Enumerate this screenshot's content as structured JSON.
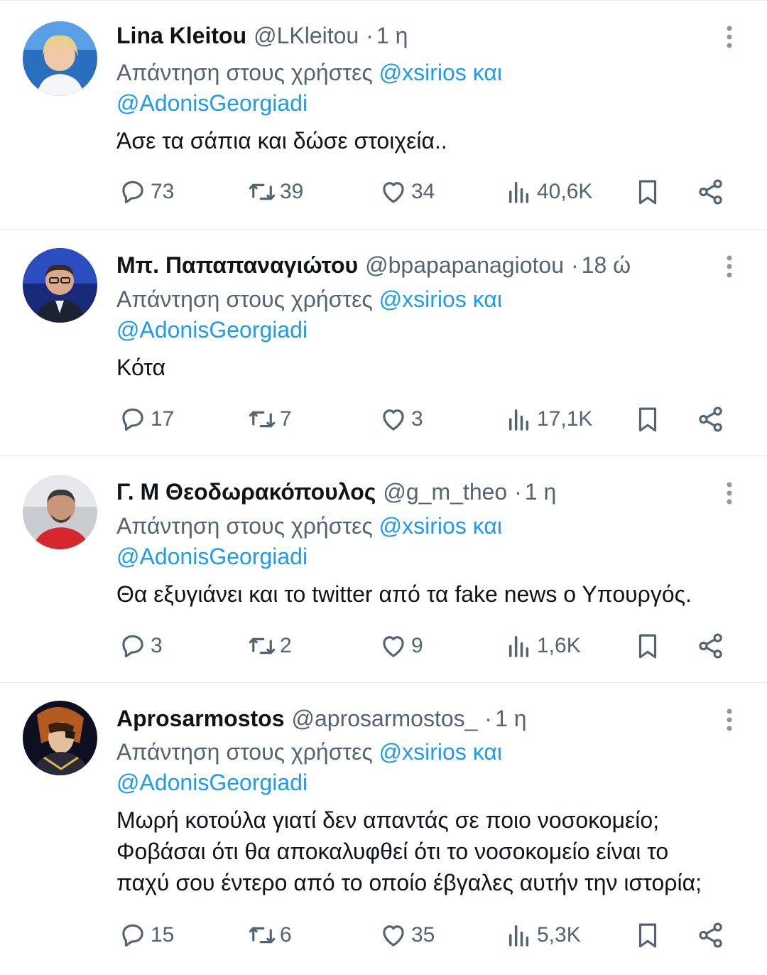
{
  "reply_prefix": "Απάντηση στους χρήστες",
  "mention_line1": "@xsirios και",
  "mention_line2": "@AdonisGeorgiadi",
  "colors": {
    "accent": "#1d9bf0",
    "secondary_text": "#536471",
    "primary_text": "#0f1419",
    "divider": "#e4e8eb"
  },
  "icons": [
    "reply-icon",
    "retweet-icon",
    "heart-icon",
    "views-icon",
    "bookmark-icon",
    "share-icon",
    "more-icon"
  ],
  "tweets": [
    {
      "name": "Lina Kleitou",
      "handle": "@LKleitou",
      "dot": "·",
      "time": "1 η",
      "text": [
        "Άσε τα σάπια και δώσε στοιχεία.."
      ],
      "replies": "73",
      "retweets": "39",
      "likes": "34",
      "views": "40,6K"
    },
    {
      "name": "Μπ. Παπαπαναγιώτου",
      "handle": "@bpapapanagiotou",
      "dot": "·",
      "time": "18 ώ",
      "text": [
        "Κότα"
      ],
      "replies": "17",
      "retweets": "7",
      "likes": "3",
      "views": "17,1K"
    },
    {
      "name": "Γ. Μ Θεοδωρακόπουλος",
      "handle": "@g_m_theo",
      "dot": "·",
      "time": "1 η",
      "text": [
        "Θα εξυγιάνει και το twitter από τα fake news ο Υπουργός."
      ],
      "replies": "3",
      "retweets": "2",
      "likes": "9",
      "views": "1,6K"
    },
    {
      "name": "Aprosarmostos",
      "handle": "@aprosarmostos_",
      "dot": "·",
      "time": "1 η",
      "text": [
        "Μωρή κοτούλα γιατί δεν απαντάς σε ποιο νοσοκομείο;",
        "Φοβάσαι ότι θα αποκαλυφθεί ότι το νοσοκομείο είναι το",
        "παχύ σου έντερο από το οποίο έβγαλες αυτήν την ιστορία;"
      ],
      "replies": "15",
      "retweets": "6",
      "likes": "35",
      "views": "5,3K"
    }
  ]
}
